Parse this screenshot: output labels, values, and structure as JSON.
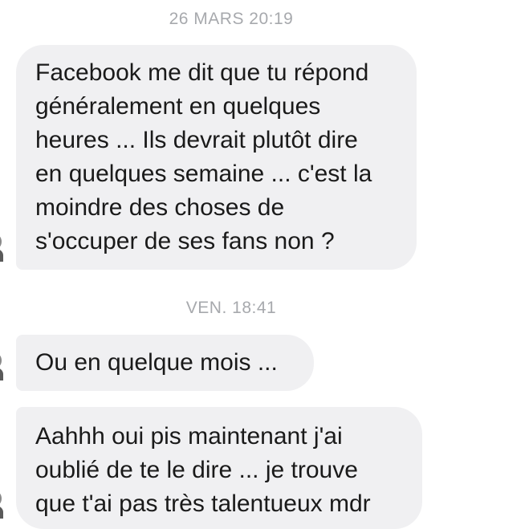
{
  "conversation": {
    "timestamps": [
      "26 MARS 20:19",
      "VEN. 18:41"
    ],
    "messages": [
      {
        "lines": [
          "Facebook me dit que tu répond",
          "généralement en quelques",
          "heures ... Ils devrait plutôt dire",
          "en quelques semaine ... c'est la",
          "moindre des choses de",
          "s'occuper de ses fans non ?"
        ]
      },
      {
        "lines": [
          "Ou en quelque mois ..."
        ]
      },
      {
        "lines": [
          "Aahhh oui pis maintenant j'ai",
          "oublié de te le dire ... je trouve",
          "que t'ai pas très talentueux mdr"
        ]
      }
    ]
  },
  "colors": {
    "bubble_background": "#f0f0f2",
    "timestamp_text": "#a7a9ad",
    "message_text": "#1a1a1a"
  }
}
